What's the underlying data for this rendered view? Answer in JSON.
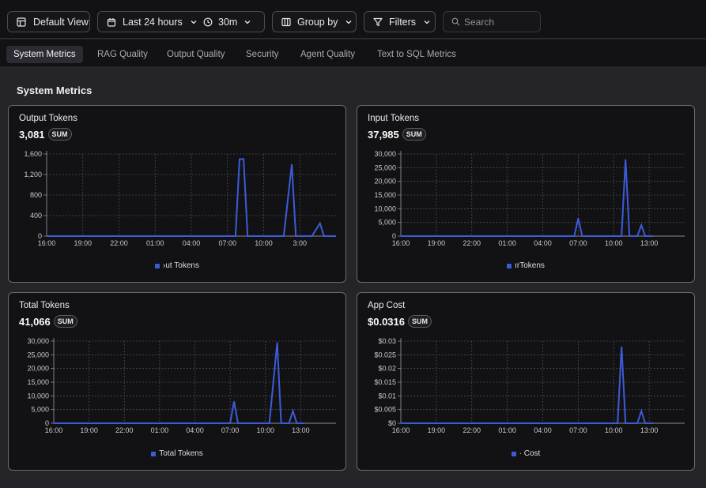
{
  "toolbar": {
    "default_view": "Default View",
    "time_range": "Last 24 hours",
    "interval": "30m",
    "group_by": "Group by",
    "filters": "Filters",
    "search_placeholder": "Search"
  },
  "tabs": [
    {
      "label": "System Metrics",
      "active": true
    },
    {
      "label": "RAG Quality"
    },
    {
      "label": "Output Quality"
    },
    {
      "label": "Security"
    },
    {
      "label": "Agent Quality"
    },
    {
      "label": "Text to SQL Metrics"
    }
  ],
  "section_title": "System Metrics",
  "colors": {
    "accent": "#3d5bd9",
    "background": "#242429",
    "panel": "#121214"
  },
  "cards": [
    {
      "title": "Output Tokens",
      "value": "3,081",
      "badge": "SUM",
      "legend": "›ut Tokens",
      "chart_data": {
        "type": "line",
        "series_name": "›ut Tokens",
        "x_ticks": [
          "16:00",
          "19:00",
          "22:00",
          "01:00",
          "04:00",
          "07:00",
          "10:00",
          "3:00"
        ],
        "y_ticks": [
          "1,600",
          "1,200",
          "800",
          "400",
          "0"
        ],
        "ylim": [
          0,
          1600
        ],
        "x": [
          0,
          47,
          48,
          49,
          50,
          52,
          53,
          59,
          61,
          62,
          64,
          66,
          68,
          69,
          71,
          72
        ],
        "values": [
          0,
          0,
          1500,
          1500,
          0,
          0,
          0,
          0,
          1400,
          0,
          0,
          0,
          250,
          0,
          0,
          0
        ],
        "grid": true
      }
    },
    {
      "title": "Input Tokens",
      "value": "37,985",
      "badge": "SUM",
      "legend": "ırTokens",
      "chart_data": {
        "type": "line",
        "series_name": "ırTokens",
        "x_ticks": [
          "16:00",
          "19:00",
          "22:00",
          "01:00",
          "04:00",
          "07:00",
          "10:00",
          "13:00"
        ],
        "y_ticks": [
          "30,000",
          "25,000",
          "20,000",
          "15,000",
          "10,000",
          "5,000",
          "0"
        ],
        "ylim": [
          0,
          30000
        ],
        "x": [
          0,
          43,
          44,
          45,
          46,
          50,
          55,
          56,
          57,
          58,
          60,
          61,
          62,
          63,
          64
        ],
        "values": [
          0,
          0,
          0,
          6500,
          0,
          0,
          0,
          0,
          28000,
          0,
          0,
          4000,
          0,
          0,
          0
        ],
        "grid": true
      }
    },
    {
      "title": "Total Tokens",
      "value": "41,066",
      "badge": "SUM",
      "legend": "Total Tokens",
      "chart_data": {
        "type": "line",
        "series_name": "Total Tokens",
        "x_ticks": [
          "16:00",
          "19:00",
          "22:00",
          "01:00",
          "04:00",
          "07:00",
          "10:00",
          "13:00"
        ],
        "y_ticks": [
          "30,000",
          "25,000",
          "20,000",
          "15,000",
          "10,000",
          "5,000",
          "0"
        ],
        "ylim": [
          0,
          30000
        ],
        "x": [
          0,
          45,
          46,
          47,
          49,
          55,
          57,
          58,
          59,
          60,
          61,
          62,
          63,
          64
        ],
        "values": [
          0,
          0,
          8000,
          0,
          0,
          0,
          29500,
          0,
          0,
          0,
          4500,
          0,
          0,
          0
        ],
        "grid": true
      }
    },
    {
      "title": "App Cost",
      "value": "$0.0316",
      "badge": "SUM",
      "legend": "· Cost",
      "chart_data": {
        "type": "line",
        "series_name": "· Cost",
        "x_ticks": [
          "16:00",
          "19:00",
          "22:00",
          "01:00",
          "04:00",
          "07:00",
          "10:00",
          "13:00"
        ],
        "y_ticks": [
          "$0.03",
          "$0.025",
          "$0.02",
          "$0.015",
          "$0.01",
          "$0.005",
          "$0"
        ],
        "ylim": [
          0,
          0.03
        ],
        "x": [
          0,
          55,
          56,
          57,
          58,
          60,
          61,
          62,
          63,
          64
        ],
        "values": [
          0,
          0,
          0.028,
          0,
          0,
          0,
          0.0045,
          0,
          0,
          0
        ],
        "grid": true
      }
    }
  ]
}
